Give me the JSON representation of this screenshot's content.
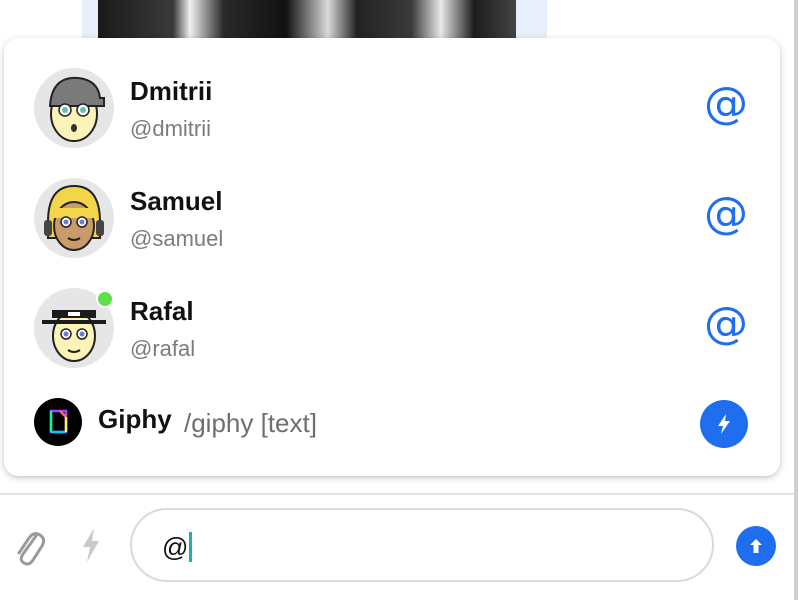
{
  "mention_suggestions": [
    {
      "name": "Dmitrii",
      "handle": "@dmitrii",
      "action_icon": "at-icon",
      "action_symbol": "@",
      "online": false
    },
    {
      "name": "Samuel",
      "handle": "@samuel",
      "action_icon": "at-icon",
      "action_symbol": "@",
      "online": false
    },
    {
      "name": "Rafal",
      "handle": "@rafal",
      "action_icon": "at-icon",
      "action_symbol": "@",
      "online": true
    }
  ],
  "command_suggestion": {
    "name": "Giphy",
    "args": "/giphy [text]",
    "icon": "lightning-icon"
  },
  "composer": {
    "value": "@",
    "attach_icon": "paperclip-icon",
    "commands_icon": "lightning-icon",
    "send_icon": "arrow-up-icon"
  },
  "colors": {
    "accent": "#1f6ef0",
    "online": "#5ee04e",
    "caret": "#1fb0a8"
  }
}
